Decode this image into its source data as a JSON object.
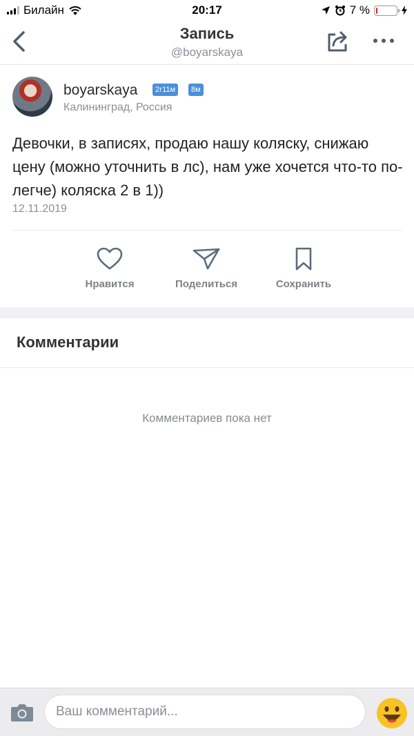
{
  "status_bar": {
    "carrier": "Билайн",
    "time": "20:17",
    "battery_percent": "7 %",
    "battery_level": 0.07,
    "icons": [
      "signal-icon",
      "wifi-icon",
      "location-arrow-icon",
      "alarm-icon",
      "battery-icon",
      "charging-bolt-icon"
    ]
  },
  "navbar": {
    "title": "Запись",
    "subtitle": "@boyarskaya",
    "icons": [
      "back-chevron-icon",
      "share-icon",
      "more-icon"
    ]
  },
  "post": {
    "author": "boyarskaya",
    "badges": [
      "2г11м",
      "8м"
    ],
    "location": "Калининград, Россия",
    "text": "Девочки, в записях, продаю нашу коляску, снижаю цену (можно уточнить в лс), нам уже хочется что-то по-легче) коляска 2 в 1))",
    "date": "12.11.2019"
  },
  "actions": [
    {
      "label": "Нравится",
      "icon": "heart-icon"
    },
    {
      "label": "Поделиться",
      "icon": "send-icon"
    },
    {
      "label": "Сохранить",
      "icon": "bookmark-icon"
    }
  ],
  "comments": {
    "heading": "Комментарии",
    "empty_text": "Комментариев пока нет"
  },
  "composer": {
    "placeholder": "Ваш комментарий...",
    "icons": [
      "camera-icon",
      "emoji-icon"
    ]
  },
  "colors": {
    "accent_gray": "#7d8287",
    "badge_blue": "#4a90d9",
    "battery_low": "#e0222a",
    "emoji_yellow": "#f7c325"
  }
}
